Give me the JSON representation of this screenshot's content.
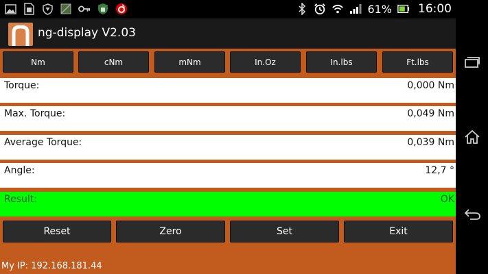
{
  "statusbar": {
    "left_icons": [
      "image-icon",
      "sim-toolkit-icon",
      "shield-icon",
      "photo-icon",
      "key-icon",
      "security-icon",
      "vodafone-icon"
    ],
    "battery_percent": "61%",
    "time": "16:00"
  },
  "appbar": {
    "title": "ng-display V2.03"
  },
  "units": [
    "Nm",
    "cNm",
    "mNm",
    "In.Oz",
    "In.lbs",
    "Ft.lbs"
  ],
  "fields": [
    {
      "label": "Torque:",
      "value": "0,000 Nm"
    },
    {
      "label": "Max. Torque:",
      "value": "0,049 Nm"
    },
    {
      "label": "Average Torque:",
      "value": "0,039 Nm"
    },
    {
      "label": "Angle:",
      "value": "12,7 °"
    }
  ],
  "result": {
    "label": "Result:",
    "value": "OK"
  },
  "actions": [
    "Reset",
    "Zero",
    "Set",
    "Exit"
  ],
  "ip_text": "My IP: 192.168.181.44",
  "colors": {
    "accent": "#c25c1e",
    "result_ok": "#00ff00",
    "button": "#2b2b2b"
  }
}
